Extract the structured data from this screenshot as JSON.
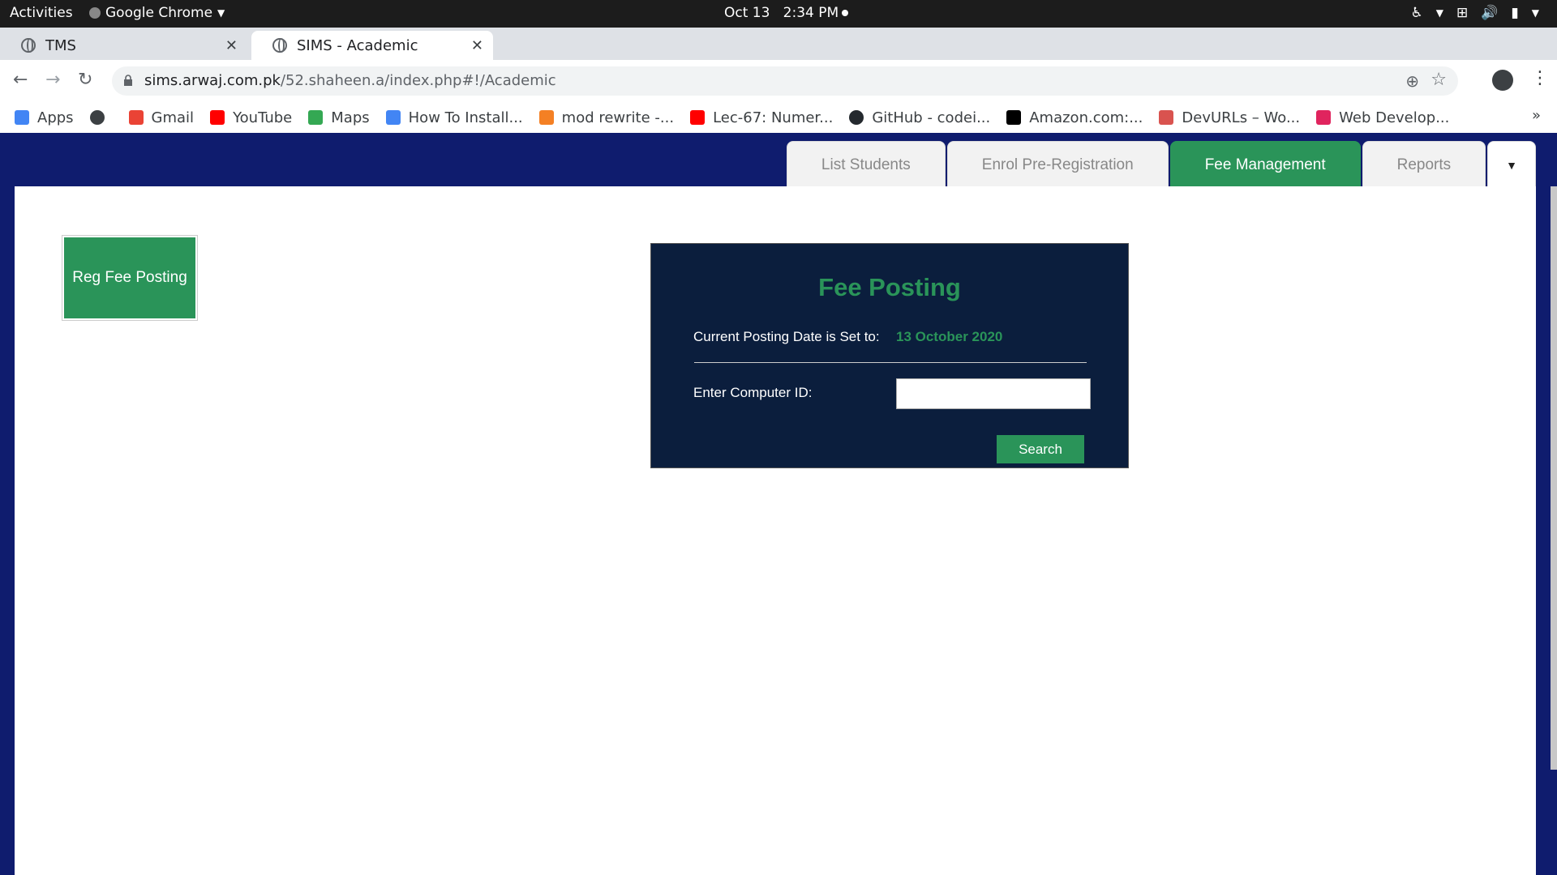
{
  "system": {
    "activities": "Activities",
    "app_name": "Google Chrome",
    "date": "Oct 13",
    "time": "2:34 PM"
  },
  "browser": {
    "tabs": [
      {
        "title": "TMS",
        "active": false
      },
      {
        "title": "SIMS - Academic",
        "active": true
      }
    ],
    "url_host": "sims.arwaj.com.pk",
    "url_path": "/52.shaheen.a/index.php#!/Academic",
    "bookmarks": [
      {
        "label": "Apps",
        "icon": "apps-grid-icon",
        "color": "#4285f4"
      },
      {
        "label": "",
        "icon": "globe-icon",
        "color": "#3c4043"
      },
      {
        "label": "Gmail",
        "icon": "gmail-icon",
        "color": "#ea4335"
      },
      {
        "label": "YouTube",
        "icon": "youtube-icon",
        "color": "#ff0000"
      },
      {
        "label": "Maps",
        "icon": "maps-pin-icon",
        "color": "#34a853"
      },
      {
        "label": "How To Install...",
        "icon": "loader-icon",
        "color": "#4285f4"
      },
      {
        "label": "mod rewrite -...",
        "icon": "stackoverflow-icon",
        "color": "#f48024"
      },
      {
        "label": "Lec-67: Numer...",
        "icon": "youtube-icon",
        "color": "#ff0000"
      },
      {
        "label": "GitHub - codei...",
        "icon": "github-icon",
        "color": "#24292e"
      },
      {
        "label": "Amazon.com:...",
        "icon": "amazon-icon",
        "color": "#000000"
      },
      {
        "label": "DevURLs – Wo...",
        "icon": "devurls-icon",
        "color": "#d9534f"
      },
      {
        "label": "Web Develop...",
        "icon": "web-dev-icon",
        "color": "#e0245e"
      }
    ]
  },
  "nav": {
    "tabs": [
      {
        "label": "List Students",
        "active": false
      },
      {
        "label": "Enrol Pre-Registration",
        "active": false
      },
      {
        "label": "Fee Management",
        "active": true
      },
      {
        "label": "Reports",
        "active": false
      }
    ],
    "dropdown_symbol": "▼"
  },
  "sidebar": {
    "reg_fee_button": "Reg Fee Posting"
  },
  "fee_posting": {
    "title": "Fee Posting",
    "date_label": "Current Posting Date is Set to:",
    "date_value": "13 October 2020",
    "computer_id_label": "Enter Computer ID:",
    "computer_id_value": "",
    "search_button": "Search"
  },
  "colors": {
    "accent_green": "#2a9459",
    "header_navy": "#0f1c6e",
    "panel_navy": "#0b1e3d"
  }
}
